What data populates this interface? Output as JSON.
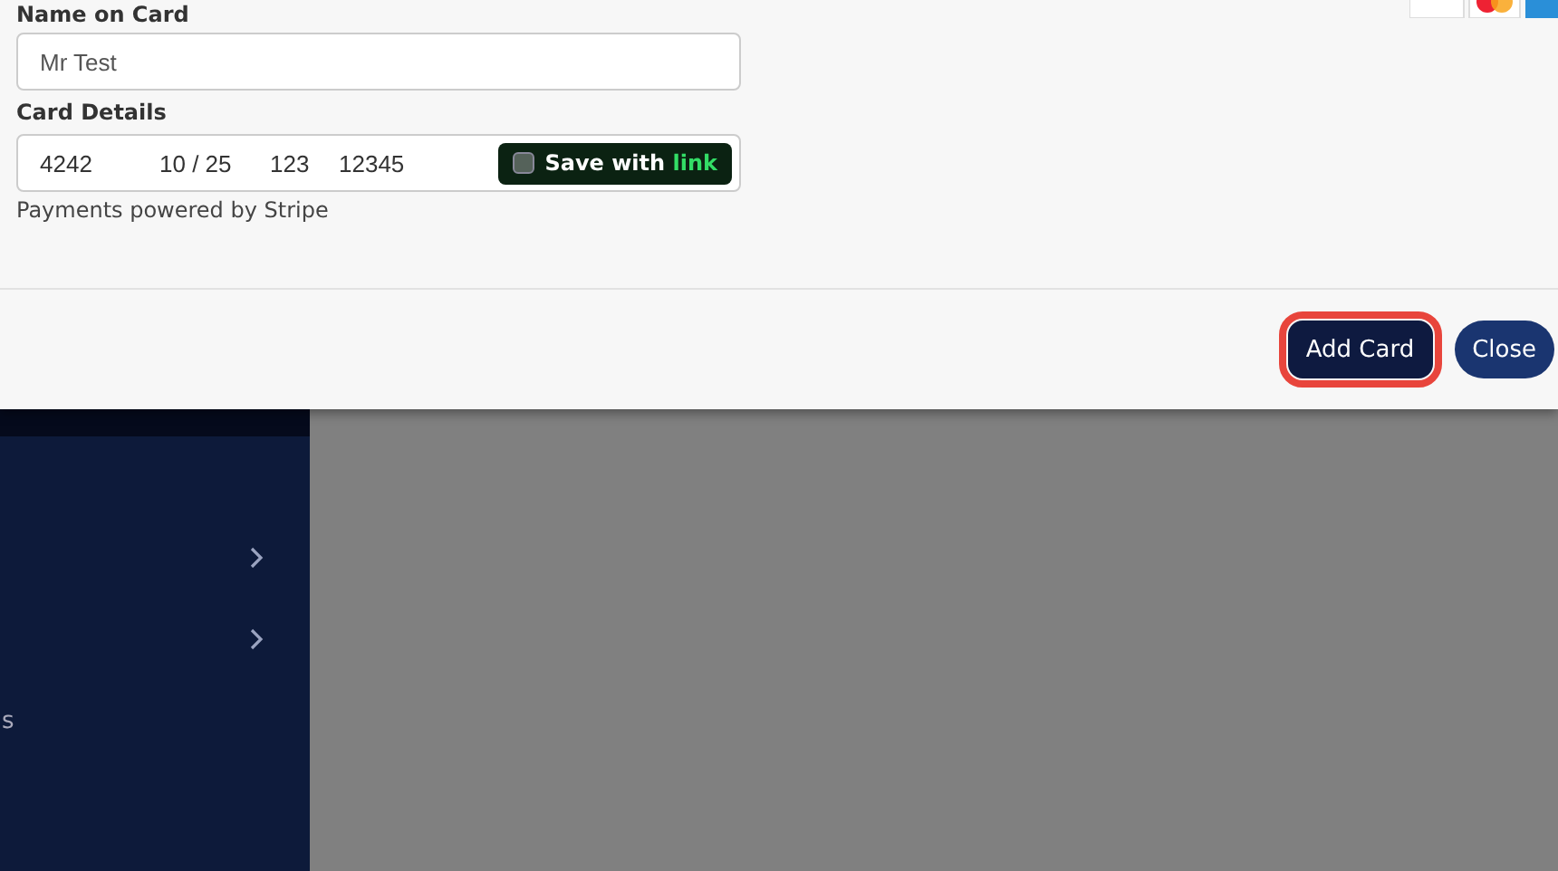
{
  "modal": {
    "name_label": "Name on Card",
    "name_value": "Mr Test",
    "card_label": "Card Details",
    "card": {
      "number": "4242",
      "expiry": "10 / 25",
      "cvc": "123",
      "zip": "12345"
    },
    "save_link": {
      "text": "Save with ",
      "brand": "link",
      "checked": false
    },
    "powered": "Payments powered by Stripe",
    "buttons": [
      {
        "label": "Add Card",
        "highlighted": true
      },
      {
        "label": "Close",
        "highlighted": false
      }
    ]
  },
  "sidebar": {
    "cut_text": "s"
  }
}
